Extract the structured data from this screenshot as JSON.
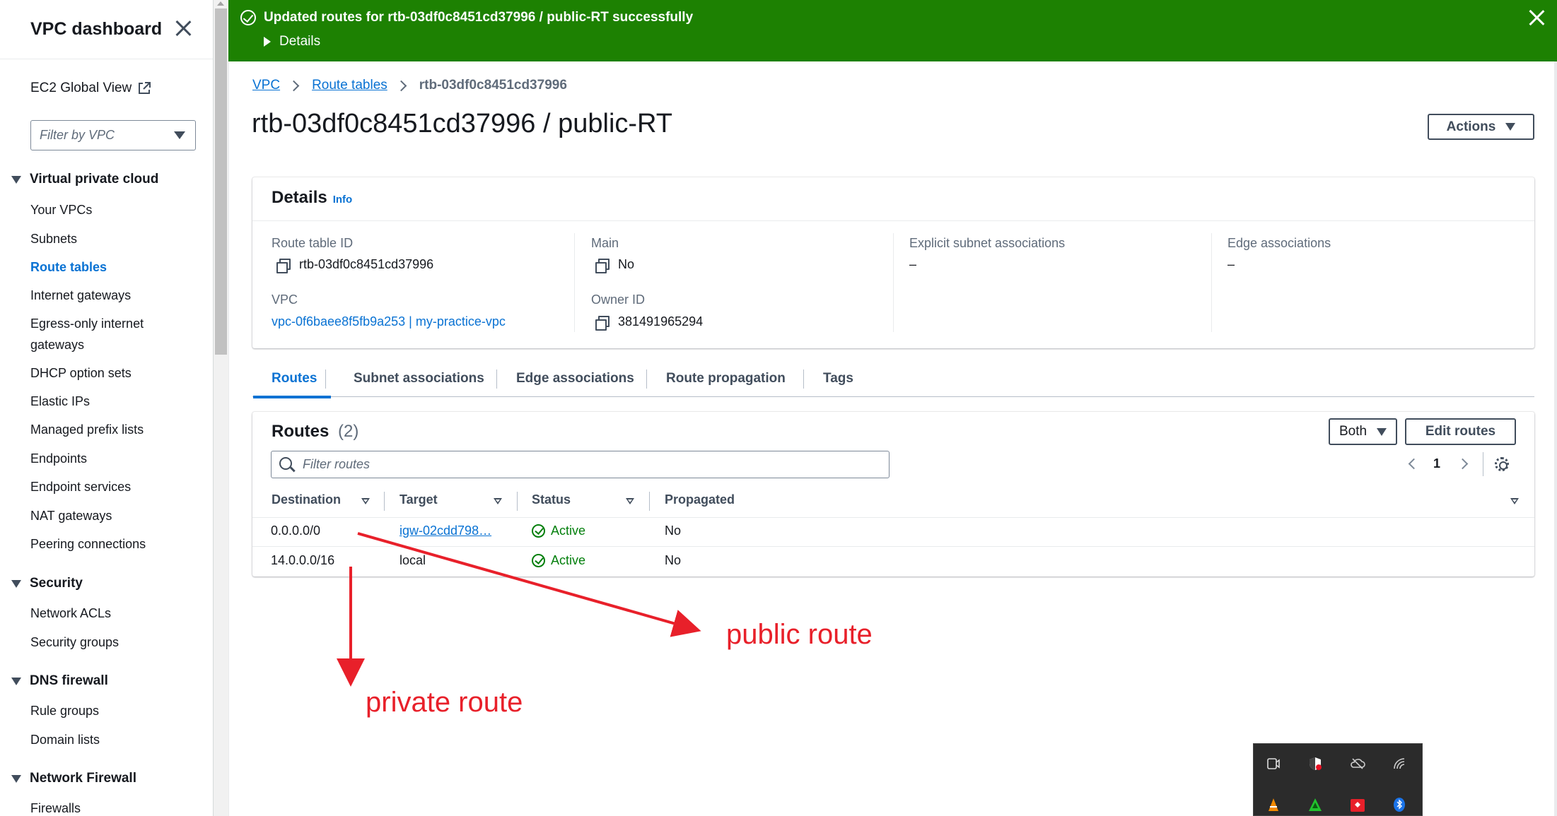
{
  "sidebar": {
    "title": "VPC dashboard",
    "global_view": "EC2 Global View",
    "filter_placeholder": "Filter by VPC",
    "sections": [
      {
        "label": "Virtual private cloud",
        "items": [
          "Your VPCs",
          "Subnets",
          "Route tables",
          "Internet gateways",
          "Egress-only internet",
          "gateways",
          "DHCP option sets",
          "Elastic IPs",
          "Managed prefix lists",
          "Endpoints",
          "Endpoint services",
          "NAT gateways",
          "Peering connections"
        ]
      },
      {
        "label": "Security",
        "items": [
          "Network ACLs",
          "Security groups"
        ]
      },
      {
        "label": "DNS firewall",
        "items": [
          "Rule groups",
          "Domain lists"
        ]
      },
      {
        "label": "Network Firewall",
        "items": [
          "Firewalls"
        ]
      }
    ]
  },
  "flash": {
    "message": "Updated routes for rtb-03df0c8451cd37996 / public-RT successfully",
    "details": "Details",
    "color": "#1d8102"
  },
  "breadcrumb": {
    "root": "VPC",
    "parent": "Route tables",
    "current": "rtb-03df0c8451cd37996"
  },
  "page_title": "rtb-03df0c8451cd37996 / public-RT",
  "actions_label": "Actions",
  "details": {
    "title": "Details",
    "info": "Info",
    "route_table_id_label": "Route table ID",
    "route_table_id": "rtb-03df0c8451cd37996",
    "main_label": "Main",
    "main": "No",
    "explicit_label": "Explicit subnet associations",
    "explicit": "–",
    "edge_label": "Edge associations",
    "edge": "–",
    "vpc_label": "VPC",
    "vpc": "vpc-0f6baee8f5fb9a253 | my-practice-vpc",
    "owner_label": "Owner ID",
    "owner": "381491965294"
  },
  "tabs": [
    "Routes",
    "Subnet associations",
    "Edge associations",
    "Route propagation",
    "Tags"
  ],
  "routes": {
    "title": "Routes",
    "count": "(2)",
    "filter_select": "Both",
    "edit_label": "Edit routes",
    "search_placeholder": "Filter routes",
    "page": "1",
    "columns": [
      "Destination",
      "Target",
      "Status",
      "Propagated"
    ],
    "rows": [
      {
        "destination": "0.0.0.0/0",
        "target": "igw-02cdd798…",
        "status": "Active",
        "propagated": "No"
      },
      {
        "destination": "14.0.0.0/16",
        "target": "local",
        "status": "Active",
        "propagated": "No"
      }
    ]
  },
  "annotations": {
    "public": "public route",
    "private": "private route",
    "color": "#e8202a"
  }
}
